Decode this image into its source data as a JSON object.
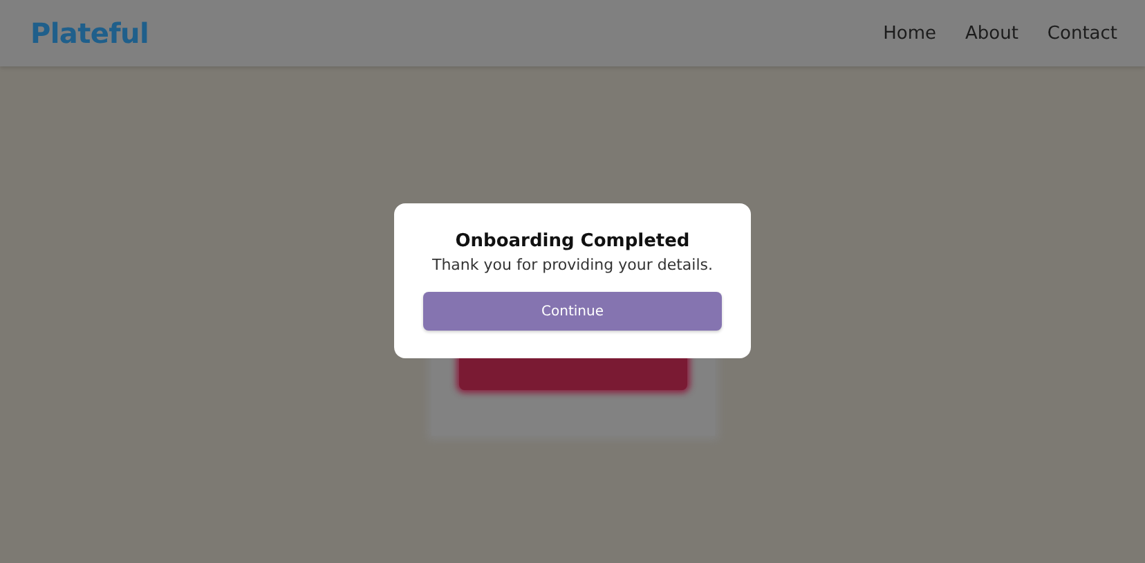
{
  "header": {
    "logo": "Plateful",
    "nav": [
      {
        "label": "Home"
      },
      {
        "label": "About"
      },
      {
        "label": "Contact"
      }
    ]
  },
  "modal": {
    "title": "Onboarding Completed",
    "message": "Thank you for providing your details.",
    "button": "Continue"
  }
}
